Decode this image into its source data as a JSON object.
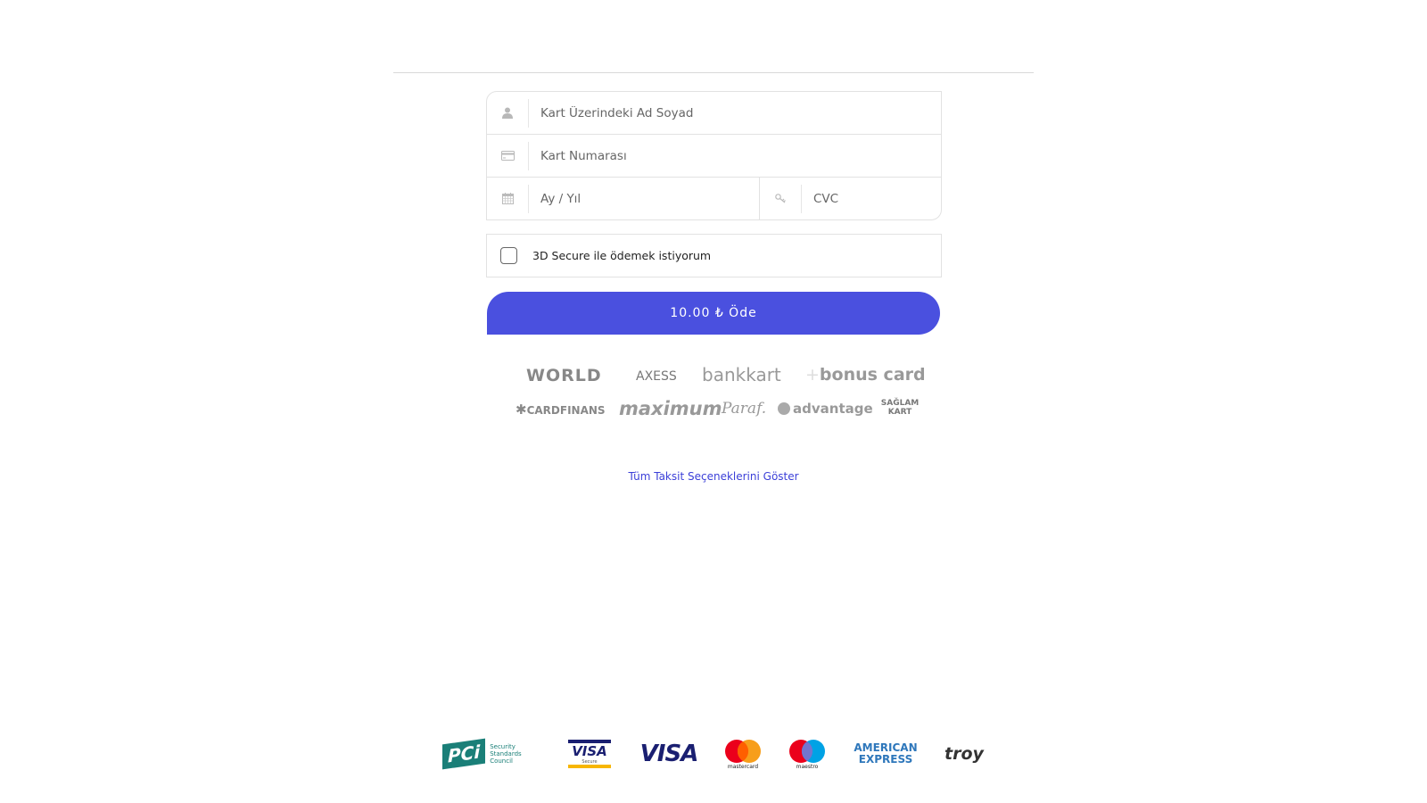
{
  "form": {
    "name_placeholder": "Kart Üzerindeki Ad Soyad",
    "card_number_placeholder": "Kart Numarası",
    "expiry_placeholder": "Ay / Yıl",
    "cvc_placeholder": "CVC",
    "icons": [
      "user-icon",
      "credit-card-icon",
      "calendar-icon",
      "key-icon"
    ]
  },
  "secure_3d": {
    "label": "3D Secure ile ödemek istiyorum",
    "checked": false
  },
  "pay_button": {
    "label": "10.00 ₺ Öde",
    "color": "#4a50df"
  },
  "bank_programs": {
    "row1": [
      "WORLD",
      "AXESS",
      "bankkart",
      "bonus card"
    ],
    "row2": [
      "CARDFINANS",
      "maximum",
      "Paraf.",
      "advantage",
      "SAĞLAM KART"
    ]
  },
  "installments_link": "Tüm Taksit Seçeneklerini Göster",
  "payment_logos": {
    "pci_main": "PCi",
    "pci_sub1": "Security",
    "pci_sub2": "Standards Council",
    "visa_secure": "VISA",
    "visa_secure_sub": "Secure",
    "visa": "VISA",
    "mastercard": "mastercard",
    "maestro": "maestro",
    "amex_line1": "AMERICAN",
    "amex_line2": "EXPRESS",
    "troy": "troy"
  }
}
